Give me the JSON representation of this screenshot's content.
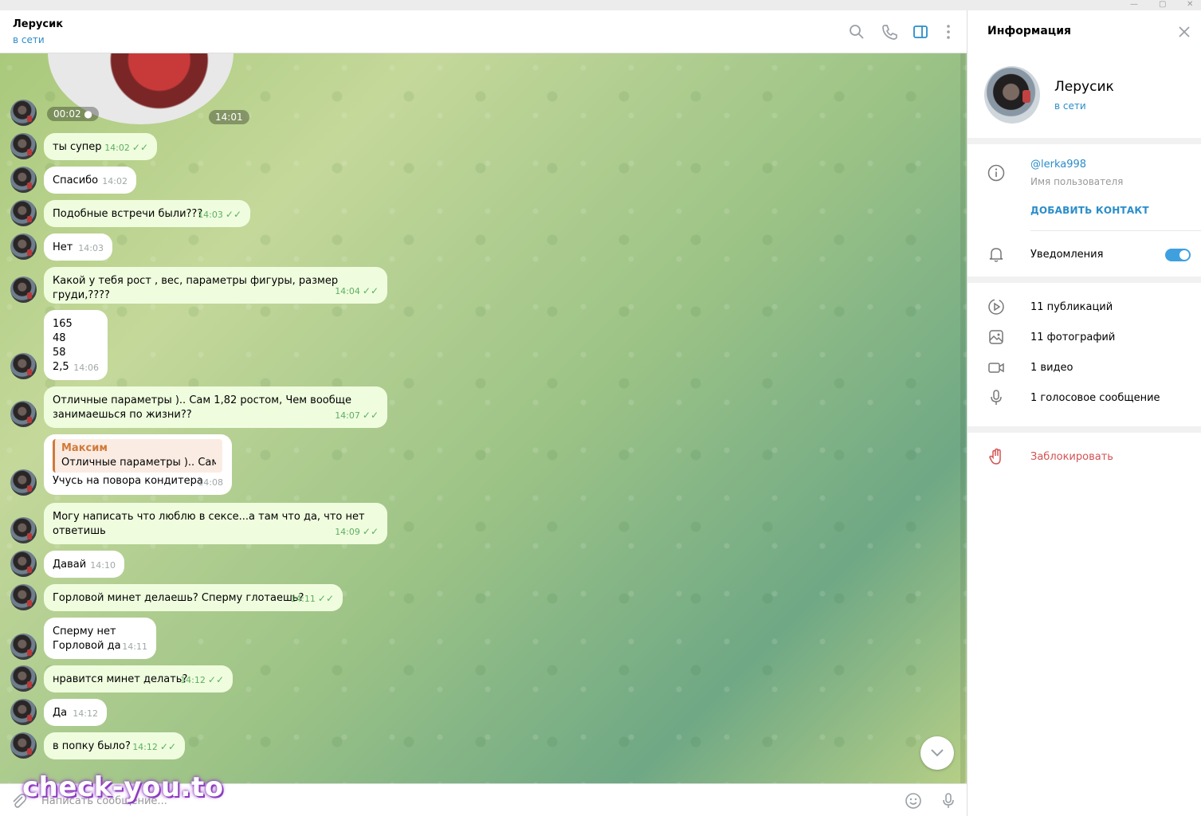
{
  "chat_header": {
    "name": "Лерусик",
    "status": "в сети"
  },
  "video_message": {
    "duration": "00:02 ●",
    "time": "14:01"
  },
  "messages": [
    {
      "text": "ты супер",
      "time": "14:02",
      "dir": "out"
    },
    {
      "text": "Спасибо",
      "time": "14:02",
      "dir": "in"
    },
    {
      "text": "Подобные встречи были???",
      "time": "14:03",
      "dir": "out"
    },
    {
      "text": "Нет",
      "time": "14:03",
      "dir": "in"
    },
    {
      "text": "Какой у тебя рост , вес, параметры фигуры, размер груди,????",
      "time": "14:04",
      "dir": "out"
    },
    {
      "text": "165\n48\n58\n2,5",
      "time": "14:06",
      "dir": "in"
    },
    {
      "text": "Отличные параметры ).. Сам 1,82 ростом, Чем вообще\nзанимаешься по жизни??",
      "time": "14:07",
      "dir": "out"
    },
    {
      "text": "Учусь на повора кондитера",
      "time": "14:08",
      "dir": "in",
      "reply_name": "Максим",
      "reply_text": "Отличные параметры ).. Сам ..."
    },
    {
      "text": "Могу написать что люблю в сексе...а там что да, что нет\nответишь",
      "time": "14:09",
      "dir": "out"
    },
    {
      "text": "Давай",
      "time": "14:10",
      "dir": "in"
    },
    {
      "text": "Горловой минет делаешь? Сперму глотаешь?",
      "time": "14:11",
      "dir": "out"
    },
    {
      "text": "Сперму нет\nГорловой да",
      "time": "14:11",
      "dir": "in"
    },
    {
      "text": "нравится минет делать?",
      "time": "14:12",
      "dir": "out"
    },
    {
      "text": "Да",
      "time": "14:12",
      "dir": "in"
    },
    {
      "text": "в попку было?",
      "time": "14:12",
      "dir": "out"
    }
  ],
  "composer": {
    "placeholder": "Написать сообщение..."
  },
  "watermark": "check-you.to",
  "panel": {
    "title": "Информация",
    "name": "Лерусик",
    "status": "в сети",
    "username": "@lerka998",
    "username_label": "Имя пользователя",
    "add_contact": "ДОБАВИТЬ КОНТАКТ",
    "notifications": "Уведомления",
    "notifications_on": true,
    "media": [
      {
        "label": "11 публикаций",
        "icon": "publications-icon"
      },
      {
        "label": "11 фотографий",
        "icon": "photo-icon"
      },
      {
        "label": "1 видео",
        "icon": "video-icon"
      },
      {
        "label": "1 голосовое сообщение",
        "icon": "microphone-icon"
      }
    ],
    "block": "Заблокировать"
  },
  "colors": {
    "accent": "#2a8dc9",
    "outgoing_bubble": "#effdde",
    "incoming_bubble": "#ffffff",
    "check": "#5dae63",
    "danger": "#d45252"
  }
}
